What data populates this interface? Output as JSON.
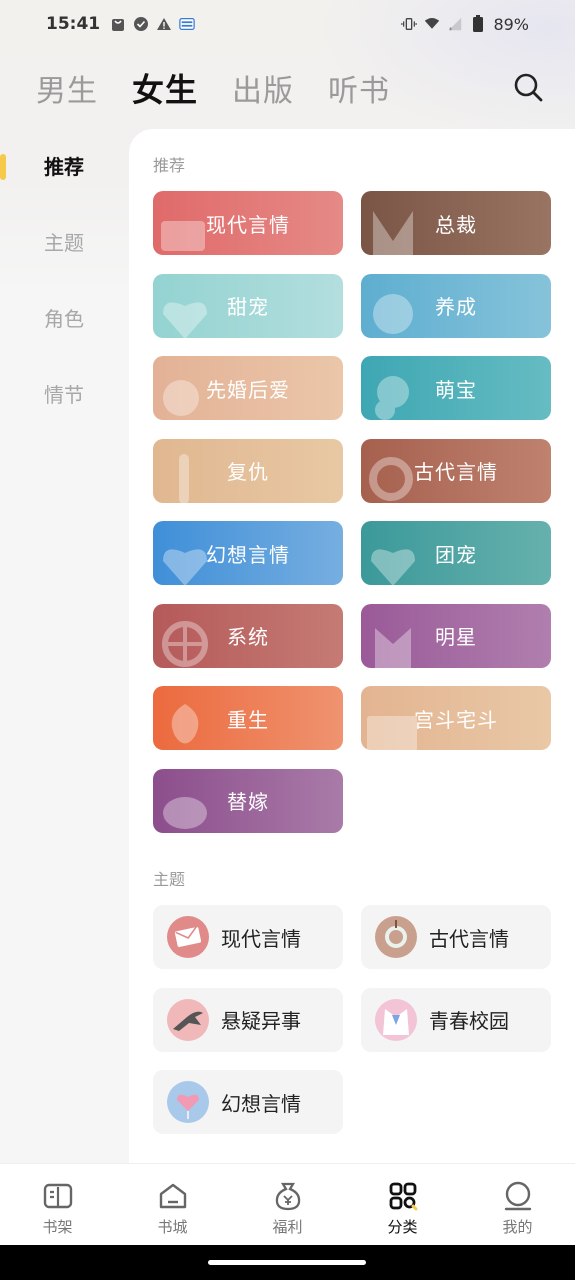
{
  "status_bar": {
    "time": "15:41",
    "battery": "89%",
    "left_icons": [
      "shopping-bag-icon",
      "check-circle-icon",
      "warning-icon",
      "news-icon"
    ],
    "right_icons": [
      "vibrate-icon",
      "wifi-icon",
      "signal-icon",
      "battery-icon"
    ]
  },
  "header": {
    "tabs": [
      {
        "label": "男生",
        "active": false
      },
      {
        "label": "女生",
        "active": true
      },
      {
        "label": "出版",
        "active": false
      },
      {
        "label": "听书",
        "active": false
      }
    ],
    "search_icon": "search-icon"
  },
  "sidebar": {
    "items": [
      {
        "label": "推荐",
        "active": true
      },
      {
        "label": "主题",
        "active": false
      },
      {
        "label": "角色",
        "active": false
      },
      {
        "label": "情节",
        "active": false
      }
    ],
    "indicator_color": "#f6c94a"
  },
  "recommend": {
    "title": "推荐",
    "cards": [
      {
        "label": "现代言情",
        "colors": [
          "#e06a6a",
          "#e58a86"
        ]
      },
      {
        "label": "总裁",
        "colors": [
          "#7a5546",
          "#9a7462"
        ]
      },
      {
        "label": "甜宠",
        "colors": [
          "#93d3d1",
          "#b3dede"
        ]
      },
      {
        "label": "养成",
        "colors": [
          "#5eaed0",
          "#86c3da"
        ]
      },
      {
        "label": "先婚后爱",
        "colors": [
          "#e3b296",
          "#ebc6a9"
        ]
      },
      {
        "label": "萌宝",
        "colors": [
          "#3ea7b3",
          "#66bcc2"
        ]
      },
      {
        "label": "复仇",
        "colors": [
          "#e0b790",
          "#e8c8a4"
        ]
      },
      {
        "label": "古代言情",
        "colors": [
          "#a6604e",
          "#bf826f"
        ]
      },
      {
        "label": "幻想言情",
        "colors": [
          "#3f8fd8",
          "#76aee0"
        ]
      },
      {
        "label": "团宠",
        "colors": [
          "#3b999a",
          "#66b1ad"
        ]
      },
      {
        "label": "系统",
        "colors": [
          "#b55a5a",
          "#c57b74"
        ]
      },
      {
        "label": "明星",
        "colors": [
          "#9a5a98",
          "#b07fae"
        ]
      },
      {
        "label": "重生",
        "colors": [
          "#ec6a3e",
          "#ef9370"
        ]
      },
      {
        "label": "宫斗宅斗",
        "colors": [
          "#e3b491",
          "#e9c8a6"
        ]
      },
      {
        "label": "替嫁",
        "colors": [
          "#8c4e8c",
          "#a97ba8"
        ]
      }
    ]
  },
  "themes": {
    "title": "主题",
    "cards": [
      {
        "label": "现代言情",
        "avatar_color": "#e08a8a",
        "icon": "envelope-icon"
      },
      {
        "label": "古代言情",
        "avatar_color": "#c9a08e",
        "icon": "jade-ring-icon"
      },
      {
        "label": "悬疑异事",
        "avatar_color": "#f0b8b8",
        "icon": "crow-icon"
      },
      {
        "label": "青春校园",
        "avatar_color": "#f3c3d6",
        "icon": "school-uniform-icon"
      },
      {
        "label": "幻想言情",
        "avatar_color": "#a9c9ea",
        "icon": "heart-balloon-icon"
      }
    ]
  },
  "bottom_nav": {
    "items": [
      {
        "label": "书架",
        "icon": "bookshelf-icon",
        "active": false
      },
      {
        "label": "书城",
        "icon": "bookstore-icon",
        "active": false
      },
      {
        "label": "福利",
        "icon": "money-bag-icon",
        "active": false
      },
      {
        "label": "分类",
        "icon": "category-grid-icon",
        "active": true
      },
      {
        "label": "我的",
        "icon": "profile-icon",
        "active": false
      }
    ]
  }
}
